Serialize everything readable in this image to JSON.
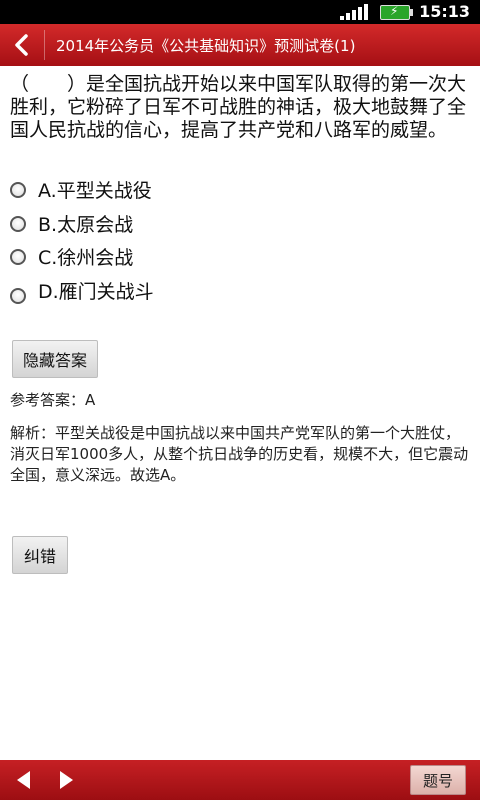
{
  "status_bar": {
    "time": "15:13"
  },
  "title_bar": {
    "title": "2014年公务员《公共基础知识》预测试卷(1)"
  },
  "question": {
    "text": "（　　）是全国抗战开始以来中国军队取得的第一次大胜利，它粉碎了日军不可战胜的神话，极大地鼓舞了全国人民抗战的信心，提高了共产党和八路军的威望。",
    "options": [
      {
        "label": "A.平型关战役"
      },
      {
        "label": "B.太原会战"
      },
      {
        "label": "C.徐州会战"
      },
      {
        "label": "D.雁门关战斗"
      }
    ]
  },
  "buttons": {
    "hide_answer": "隐藏答案",
    "report_error": "纠错",
    "question_number": "题号"
  },
  "answer": {
    "text": "参考答案：A"
  },
  "analysis": {
    "text": "解析：平型关战役是中国抗战以来中国共产党军队的第一个大胜仗，消灭日军1000多人，从整个抗日战争的历史看，规模不大，但它震动全国，意义深远。故选A。"
  },
  "icons": {
    "back": "chevron-left-icon",
    "prev": "triangle-left-icon",
    "next": "triangle-right-icon"
  },
  "colors": {
    "accent": "#b81a1f"
  }
}
